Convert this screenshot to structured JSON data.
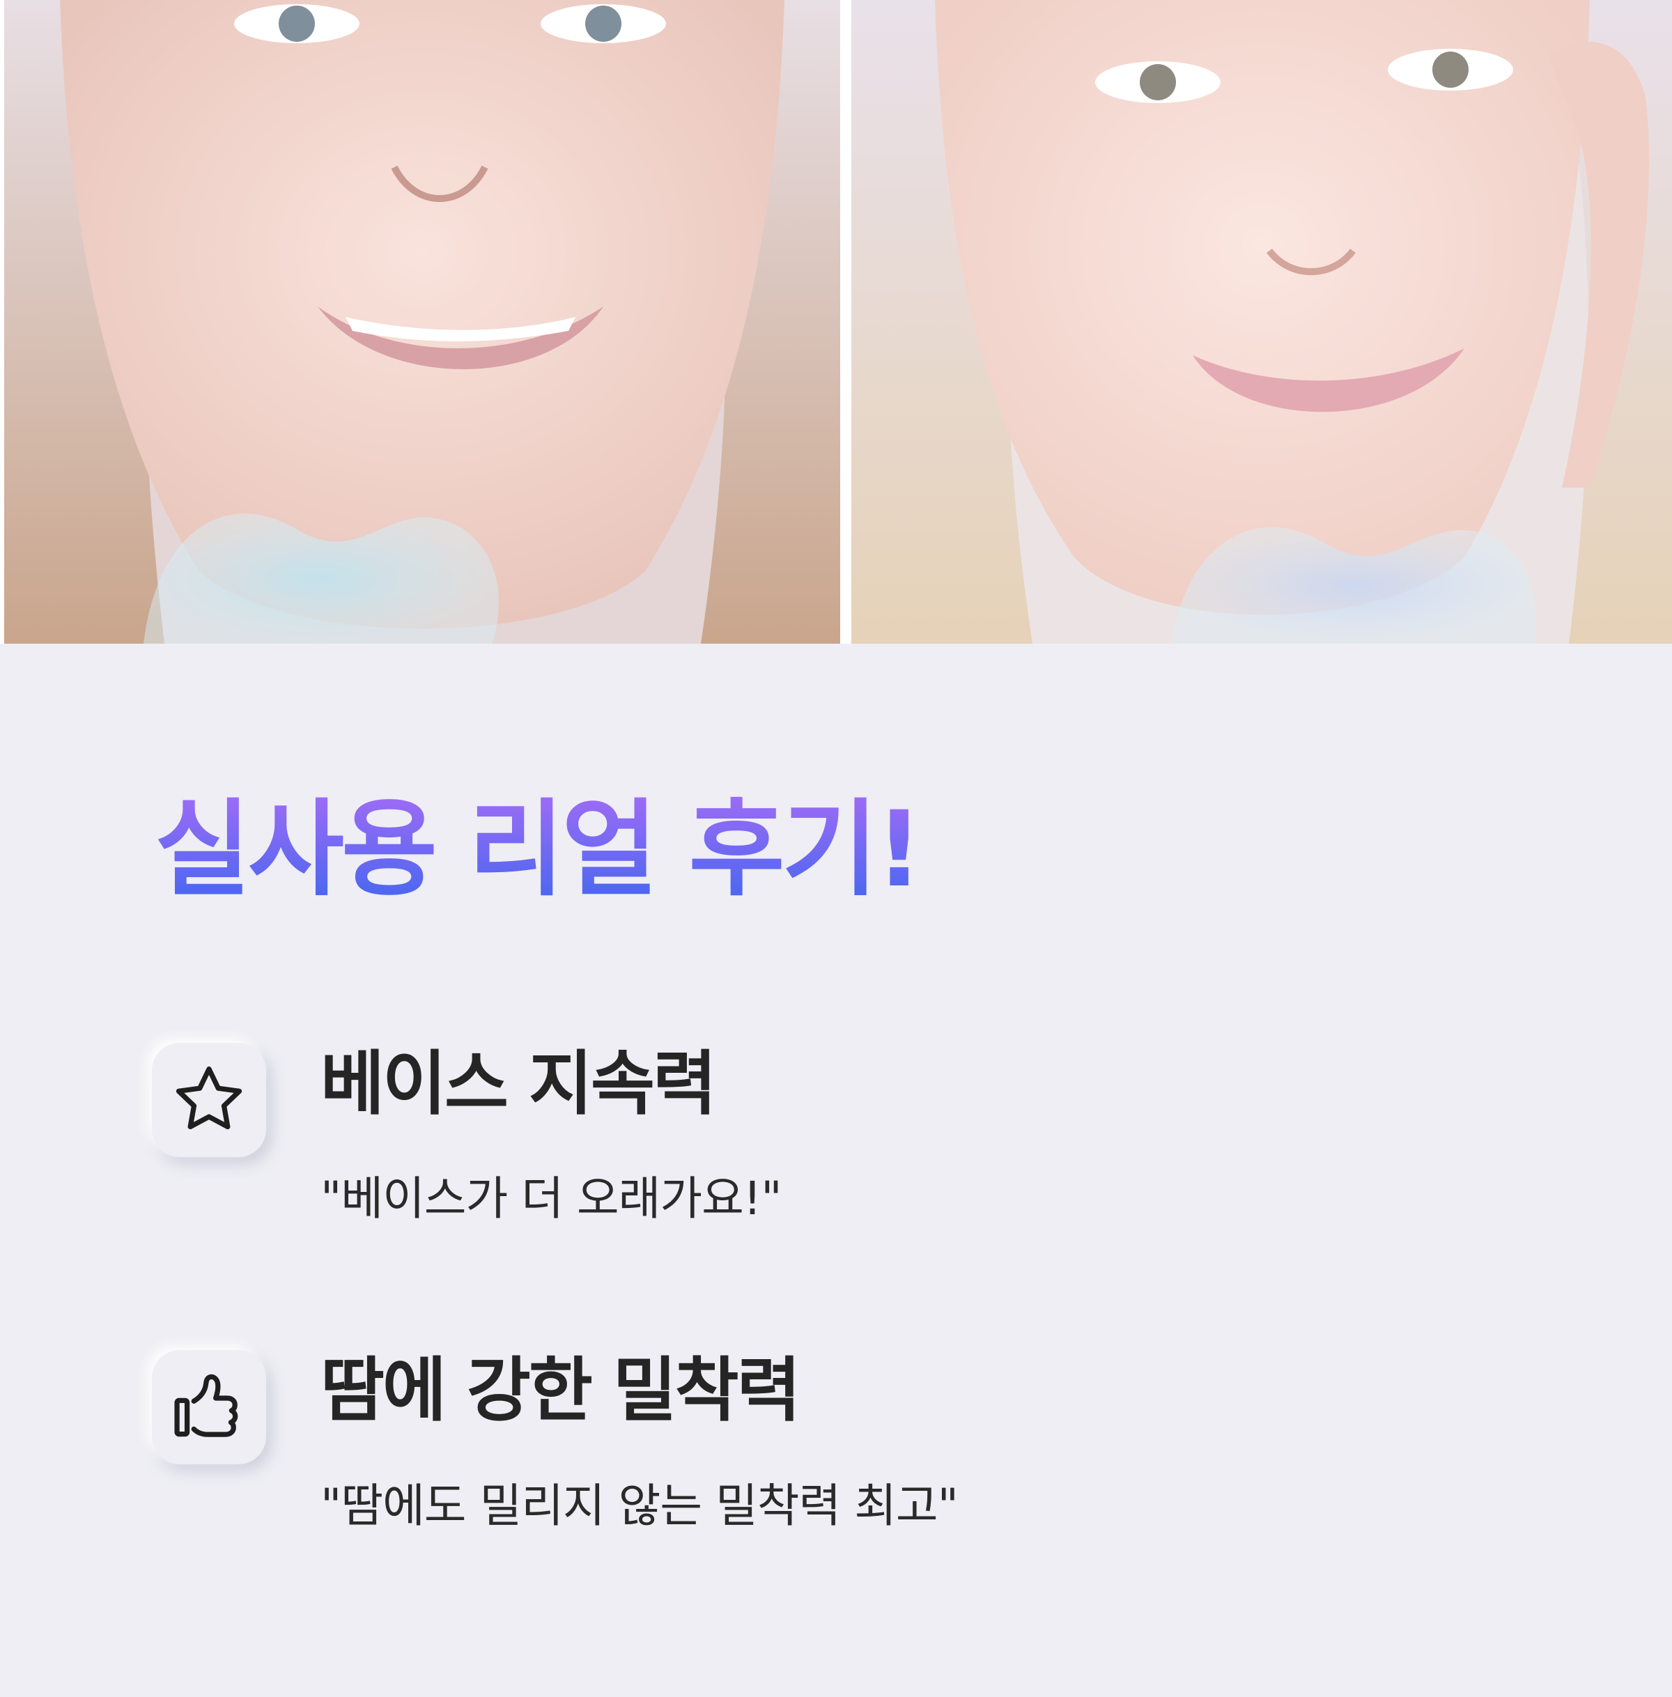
{
  "title": "실사용 리얼 후기!",
  "points": [
    {
      "icon": "star-icon",
      "title": "베이스 지속력",
      "quote": "\"베이스가 더 오래가요!\""
    },
    {
      "icon": "thumbs-up-icon",
      "title": "땀에 강한 밀착력",
      "quote": "\"땀에도 밀리지 않는 밀착력 최고\""
    }
  ],
  "colors": {
    "background": "#eeeef4",
    "title_gradient_top": "#a46cf6",
    "title_gradient_bottom": "#3f66ef",
    "text": "#252525"
  }
}
